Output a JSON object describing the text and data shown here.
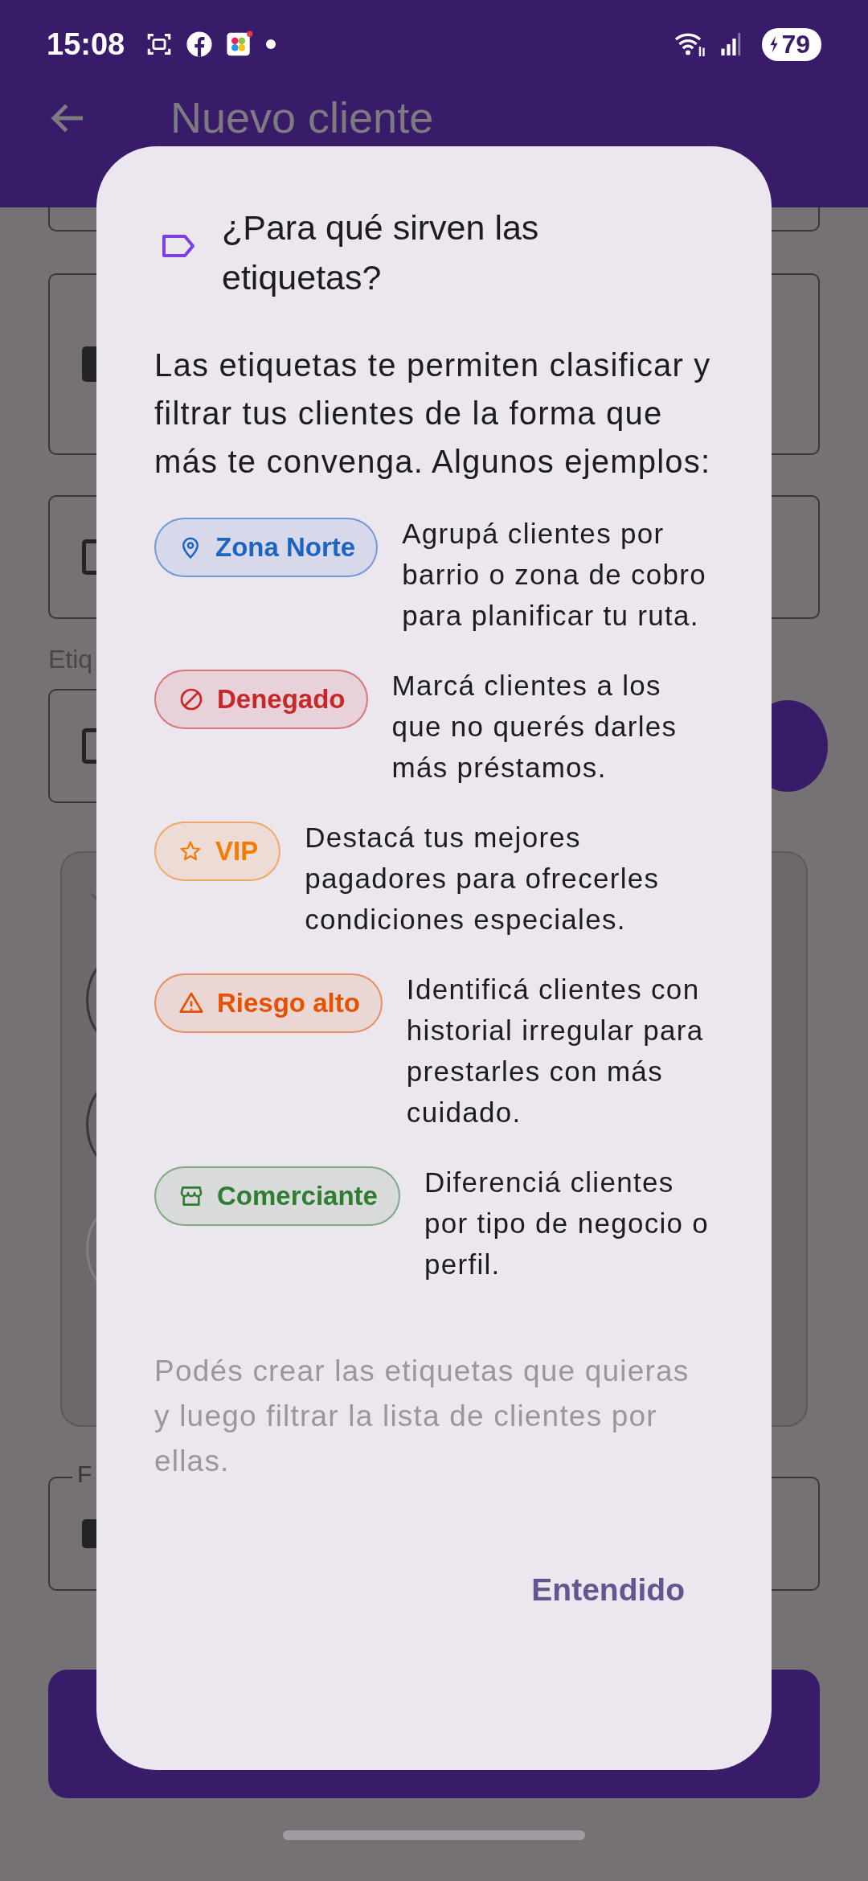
{
  "status_bar": {
    "time": "15:08",
    "battery": "79"
  },
  "app_bar": {
    "title": "Nuevo cliente"
  },
  "form": {
    "tags_label": "Etiq",
    "date_label": "F"
  },
  "dialog": {
    "title": "¿Para qué sirven las etiquetas?",
    "intro": "Las etiquetas te permiten clasificar y filtrar tus clientes de la forma que más te convenga. Algunos ejemplos:",
    "examples": [
      {
        "kind": "pin",
        "label": "Zona Norte",
        "color": "#1c64c0",
        "description": "Agrupá clientes por barrio o zona de cobro para planificar tu ruta."
      },
      {
        "kind": "block",
        "label": "Denegado",
        "color": "#c62828",
        "description": "Marcá clientes a los que no querés darles más préstamos."
      },
      {
        "kind": "star",
        "label": "VIP",
        "color": "#f57c00",
        "description": "Destacá tus mejores pagadores para ofrecerles condiciones especiales."
      },
      {
        "kind": "warning",
        "label": "Riesgo alto",
        "color": "#e65100",
        "description": "Identificá clientes con historial irregular para prestarles con más cuidado."
      },
      {
        "kind": "store",
        "label": "Comerciante",
        "color": "#2e7d32",
        "description": "Diferenciá clientes por tipo de negocio o perfil."
      }
    ],
    "footnote": "Podés crear las etiquetas que quieras y luego filtrar la lista de clientes por ellas.",
    "button": "Entendido"
  }
}
